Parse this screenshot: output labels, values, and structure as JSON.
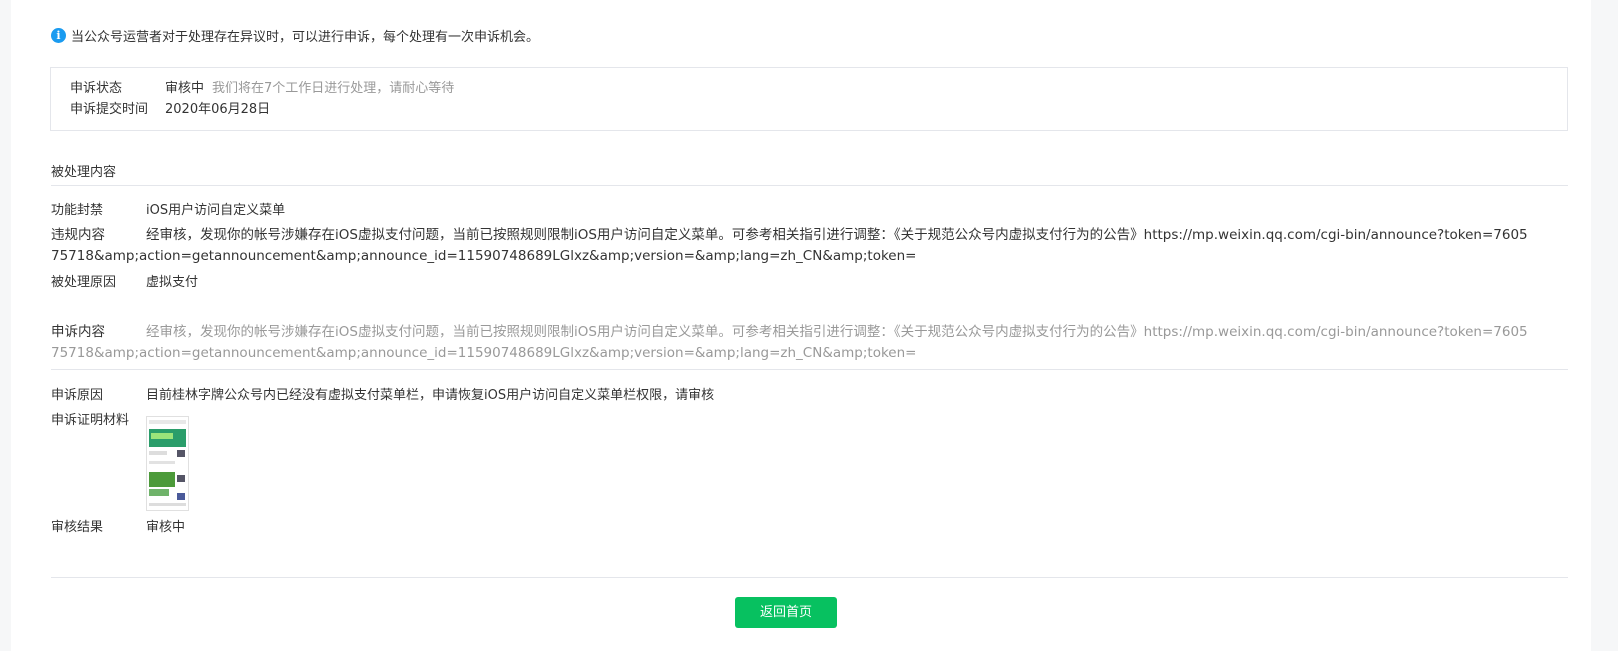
{
  "notice": {
    "icon": "info-icon",
    "text": "当公众号运营者对于处理存在异议时，可以进行申诉，每个处理有一次申诉机会。"
  },
  "status": {
    "state_label": "申诉状态",
    "state_value": "审核中",
    "state_tip": "我们将在7个工作日进行处理，请耐心等待",
    "time_label": "申诉提交时间",
    "time_value": "2020年06月28日"
  },
  "processed": {
    "title": "被处理内容",
    "function_label": "功能封禁",
    "function_value": "iOS用户访问自定义菜单",
    "violation_label": "违规内容",
    "violation_value": "经审核，发现你的帐号涉嫌存在iOS虚拟支付问题，当前已按照规则限制iOS用户访问自定义菜单。可参考相关指引进行调整：《关于规范公众号内虚拟支付行为的公告》https://mp.weixin.qq.com/cgi-bin/announce?token=760575718&amp;action=getannouncement&amp;announce_id=11590748689LGlxz&amp;version=&amp;lang=zh_CN&amp;token=",
    "reason_label": "被处理原因",
    "reason_value": "虚拟支付"
  },
  "appeal": {
    "content_label": "申诉内容",
    "content_value": "经审核，发现你的帐号涉嫌存在iOS虚拟支付问题，当前已按照规则限制iOS用户访问自定义菜单。可参考相关指引进行调整：《关于规范公众号内虚拟支付行为的公告》https://mp.weixin.qq.com/cgi-bin/announce?token=760575718&amp;action=getannouncement&amp;announce_id=11590748689LGlxz&amp;version=&amp;lang=zh_CN&amp;token=",
    "reason_label": "申诉原因",
    "reason_value": "目前桂林字牌公众号内已经没有虚拟支付菜单栏，申请恢复iOS用户访问自定义菜单栏权限，请审核",
    "evidence_label": "申诉证明材料",
    "result_label": "审核结果",
    "result_value": "审核中"
  },
  "footer": {
    "back_button": "返回首页"
  },
  "colors": {
    "accent_green": "#07c160",
    "info_blue": "#1a9bf0",
    "muted_text": "#999999"
  }
}
